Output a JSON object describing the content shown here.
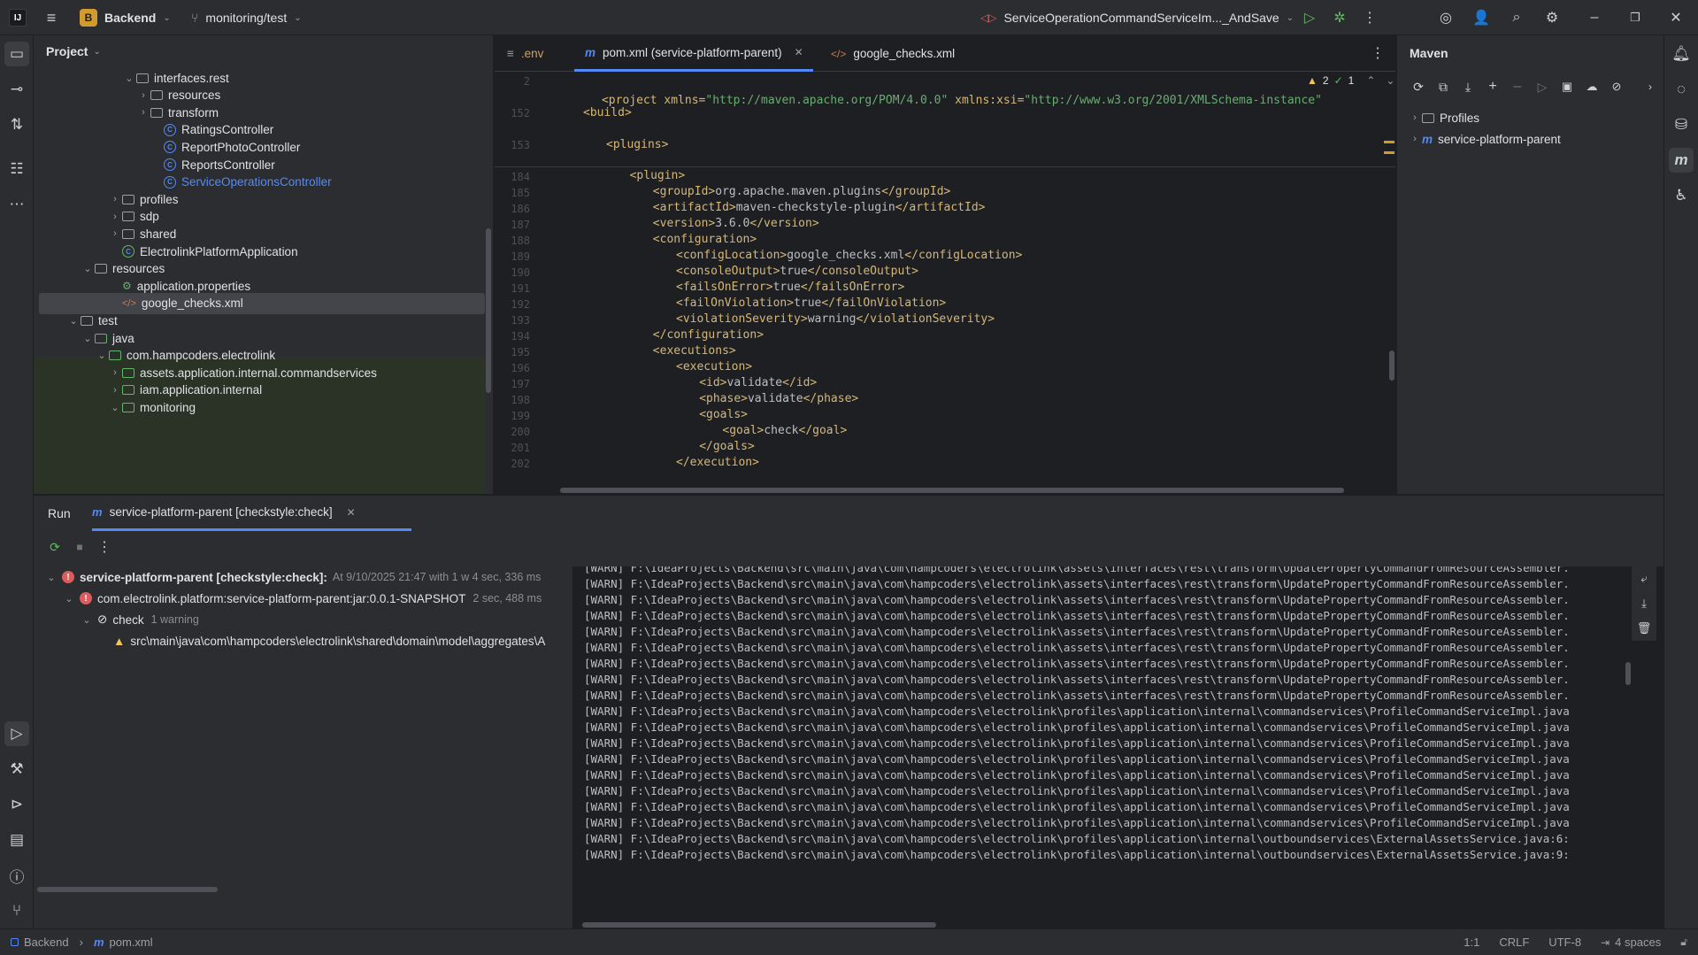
{
  "titlebar": {
    "project_badge": "B",
    "project_name": "Backend",
    "branch": "monitoring/test",
    "run_config": "ServiceOperationCommandServiceIm..._AndSave"
  },
  "project_panel": {
    "title": "Project",
    "items": [
      {
        "label": "interfaces.rest",
        "type": "folder",
        "expanded": true
      },
      {
        "label": "resources",
        "type": "folder",
        "expanded": false
      },
      {
        "label": "transform",
        "type": "folder",
        "expanded": false
      },
      {
        "label": "RatingsController",
        "type": "class"
      },
      {
        "label": "ReportPhotoController",
        "type": "class"
      },
      {
        "label": "ReportsController",
        "type": "class"
      },
      {
        "label": "ServiceOperationsController",
        "type": "class"
      },
      {
        "label": "profiles",
        "type": "folder",
        "expanded": false
      },
      {
        "label": "sdp",
        "type": "folder",
        "expanded": false
      },
      {
        "label": "shared",
        "type": "folder",
        "expanded": false
      },
      {
        "label": "ElectrolinkPlatformApplication",
        "type": "spring"
      },
      {
        "label": "resources",
        "type": "folder",
        "expanded": true
      },
      {
        "label": "application.properties",
        "type": "props"
      },
      {
        "label": "google_checks.xml",
        "type": "xml",
        "selected": true
      },
      {
        "label": "test",
        "type": "folder",
        "expanded": true
      },
      {
        "label": "java",
        "type": "folder",
        "expanded": true
      },
      {
        "label": "com.hampcoders.electrolink",
        "type": "folder",
        "expanded": true
      },
      {
        "label": "assets.application.internal.commandservices",
        "type": "folder",
        "expanded": false
      },
      {
        "label": "iam.application.internal",
        "type": "folder",
        "expanded": false
      },
      {
        "label": "monitoring",
        "type": "folder",
        "expanded": true
      }
    ]
  },
  "editor": {
    "tabs": [
      {
        "label": ".env",
        "active": false
      },
      {
        "label": "pom.xml (service-platform-parent)",
        "active": true
      },
      {
        "label": "google_checks.xml",
        "active": false
      }
    ],
    "warnings_count": "2",
    "ok_count": "1",
    "sticky": [
      {
        "num": "2",
        "pre": "<project xmlns=",
        "val": "\"http://maven.apache.org/POM/4.0.0\"",
        "mid": " xmlns:xsi=",
        "val2": "\"http://www.w3.org/2001/XMLSchema-instance\""
      },
      {
        "num": "152",
        "text": "<build>"
      },
      {
        "num": "153",
        "text": "<plugins>"
      }
    ],
    "lines": [
      {
        "num": "184",
        "indent": 6,
        "open": "<plugin>",
        "content": "",
        "close": ""
      },
      {
        "num": "185",
        "indent": 8,
        "open": "<groupId>",
        "content": "org.apache.maven.plugins",
        "close": "</groupId>"
      },
      {
        "num": "186",
        "indent": 8,
        "open": "<artifactId>",
        "content": "maven-checkstyle-plugin",
        "close": "</artifactId>"
      },
      {
        "num": "187",
        "indent": 8,
        "open": "<version>",
        "content": "3.6.0",
        "close": "</version>"
      },
      {
        "num": "188",
        "indent": 8,
        "open": "<configuration>",
        "content": "",
        "close": ""
      },
      {
        "num": "189",
        "indent": 10,
        "open": "<configLocation>",
        "content": "google_checks.xml",
        "close": "</configLocation>"
      },
      {
        "num": "190",
        "indent": 10,
        "open": "<consoleOutput>",
        "content": "true",
        "close": "</consoleOutput>"
      },
      {
        "num": "191",
        "indent": 10,
        "open": "<failsOnError>",
        "content": "true",
        "close": "</failsOnError>"
      },
      {
        "num": "192",
        "indent": 10,
        "open": "<failOnViolation>",
        "content": "true",
        "close": "</failOnViolation>"
      },
      {
        "num": "193",
        "indent": 10,
        "open": "<violationSeverity>",
        "content": "warning",
        "close": "</violationSeverity>"
      },
      {
        "num": "194",
        "indent": 8,
        "open": "</configuration>",
        "content": "",
        "close": ""
      },
      {
        "num": "195",
        "indent": 8,
        "open": "<executions>",
        "content": "",
        "close": ""
      },
      {
        "num": "196",
        "indent": 10,
        "open": "<execution>",
        "content": "",
        "close": ""
      },
      {
        "num": "197",
        "indent": 12,
        "open": "<id>",
        "content": "validate",
        "close": "</id>"
      },
      {
        "num": "198",
        "indent": 12,
        "open": "<phase>",
        "content": "validate",
        "close": "</phase>"
      },
      {
        "num": "199",
        "indent": 12,
        "open": "<goals>",
        "content": "",
        "close": ""
      },
      {
        "num": "200",
        "indent": 14,
        "open": "<goal>",
        "content": "check",
        "close": "</goal>"
      },
      {
        "num": "201",
        "indent": 12,
        "open": "</goals>",
        "content": "",
        "close": ""
      },
      {
        "num": "202",
        "indent": 10,
        "open": "</execution>",
        "content": "",
        "close": ""
      }
    ]
  },
  "maven": {
    "title": "Maven",
    "items": [
      {
        "label": "Profiles"
      },
      {
        "label": "service-platform-parent"
      }
    ]
  },
  "run": {
    "label": "Run",
    "tab": "service-platform-parent [checkstyle:check]",
    "tree": [
      {
        "label": "service-platform-parent [checkstyle:check]:",
        "meta": "At 9/10/2025 21:47 with 1 w 4 sec, 336 ms"
      },
      {
        "label": "com.electrolink.platform:service-platform-parent:jar:0.0.1-SNAPSHOT",
        "meta": "2 sec, 488 ms"
      },
      {
        "label": "check",
        "meta": "1 warning"
      },
      {
        "label": "src\\main\\java\\com\\hampcoders\\electrolink\\shared\\domain\\model\\aggregates\\A",
        "meta": ""
      }
    ],
    "log": [
      "[WARN] F:\\IdeaProjects\\Backend\\src\\main\\java\\com\\hampcoders\\electrolink\\assets\\interfaces\\rest\\transform\\UpdatePropertyCommandFromResourceAssembler.",
      "[WARN] F:\\IdeaProjects\\Backend\\src\\main\\java\\com\\hampcoders\\electrolink\\assets\\interfaces\\rest\\transform\\UpdatePropertyCommandFromResourceAssembler.",
      "[WARN] F:\\IdeaProjects\\Backend\\src\\main\\java\\com\\hampcoders\\electrolink\\assets\\interfaces\\rest\\transform\\UpdatePropertyCommandFromResourceAssembler.",
      "[WARN] F:\\IdeaProjects\\Backend\\src\\main\\java\\com\\hampcoders\\electrolink\\assets\\interfaces\\rest\\transform\\UpdatePropertyCommandFromResourceAssembler.",
      "[WARN] F:\\IdeaProjects\\Backend\\src\\main\\java\\com\\hampcoders\\electrolink\\assets\\interfaces\\rest\\transform\\UpdatePropertyCommandFromResourceAssembler.",
      "[WARN] F:\\IdeaProjects\\Backend\\src\\main\\java\\com\\hampcoders\\electrolink\\assets\\interfaces\\rest\\transform\\UpdatePropertyCommandFromResourceAssembler.",
      "[WARN] F:\\IdeaProjects\\Backend\\src\\main\\java\\com\\hampcoders\\electrolink\\assets\\interfaces\\rest\\transform\\UpdatePropertyCommandFromResourceAssembler.",
      "[WARN] F:\\IdeaProjects\\Backend\\src\\main\\java\\com\\hampcoders\\electrolink\\assets\\interfaces\\rest\\transform\\UpdatePropertyCommandFromResourceAssembler.",
      "[WARN] F:\\IdeaProjects\\Backend\\src\\main\\java\\com\\hampcoders\\electrolink\\assets\\interfaces\\rest\\transform\\UpdatePropertyCommandFromResourceAssembler.",
      "[WARN] F:\\IdeaProjects\\Backend\\src\\main\\java\\com\\hampcoders\\electrolink\\profiles\\application\\internal\\commandservices\\ProfileCommandServiceImpl.java",
      "[WARN] F:\\IdeaProjects\\Backend\\src\\main\\java\\com\\hampcoders\\electrolink\\profiles\\application\\internal\\commandservices\\ProfileCommandServiceImpl.java",
      "[WARN] F:\\IdeaProjects\\Backend\\src\\main\\java\\com\\hampcoders\\electrolink\\profiles\\application\\internal\\commandservices\\ProfileCommandServiceImpl.java",
      "[WARN] F:\\IdeaProjects\\Backend\\src\\main\\java\\com\\hampcoders\\electrolink\\profiles\\application\\internal\\commandservices\\ProfileCommandServiceImpl.java",
      "[WARN] F:\\IdeaProjects\\Backend\\src\\main\\java\\com\\hampcoders\\electrolink\\profiles\\application\\internal\\commandservices\\ProfileCommandServiceImpl.java",
      "[WARN] F:\\IdeaProjects\\Backend\\src\\main\\java\\com\\hampcoders\\electrolink\\profiles\\application\\internal\\commandservices\\ProfileCommandServiceImpl.java",
      "[WARN] F:\\IdeaProjects\\Backend\\src\\main\\java\\com\\hampcoders\\electrolink\\profiles\\application\\internal\\commandservices\\ProfileCommandServiceImpl.java",
      "[WARN] F:\\IdeaProjects\\Backend\\src\\main\\java\\com\\hampcoders\\electrolink\\profiles\\application\\internal\\commandservices\\ProfileCommandServiceImpl.java",
      "[WARN] F:\\IdeaProjects\\Backend\\src\\main\\java\\com\\hampcoders\\electrolink\\profiles\\application\\internal\\outboundservices\\ExternalAssetsService.java:6:",
      "[WARN] F:\\IdeaProjects\\Backend\\src\\main\\java\\com\\hampcoders\\electrolink\\profiles\\application\\internal\\outboundservices\\ExternalAssetsService.java:9:"
    ]
  },
  "statusbar": {
    "crumb_project": "Backend",
    "crumb_file": "pom.xml",
    "position": "1:1",
    "line_sep": "CRLF",
    "encoding": "UTF-8",
    "indent": "4 spaces"
  },
  "colors": {
    "bg": "#1e1f22",
    "panel": "#2b2d30",
    "accent": "#548af7",
    "xml_tag": "#d5b778",
    "xml_string": "#6aab73",
    "warning": "#f2c55c",
    "error": "#db5c5c",
    "run_green": "#5fb865",
    "test_folder_bg": "#2a3326"
  }
}
